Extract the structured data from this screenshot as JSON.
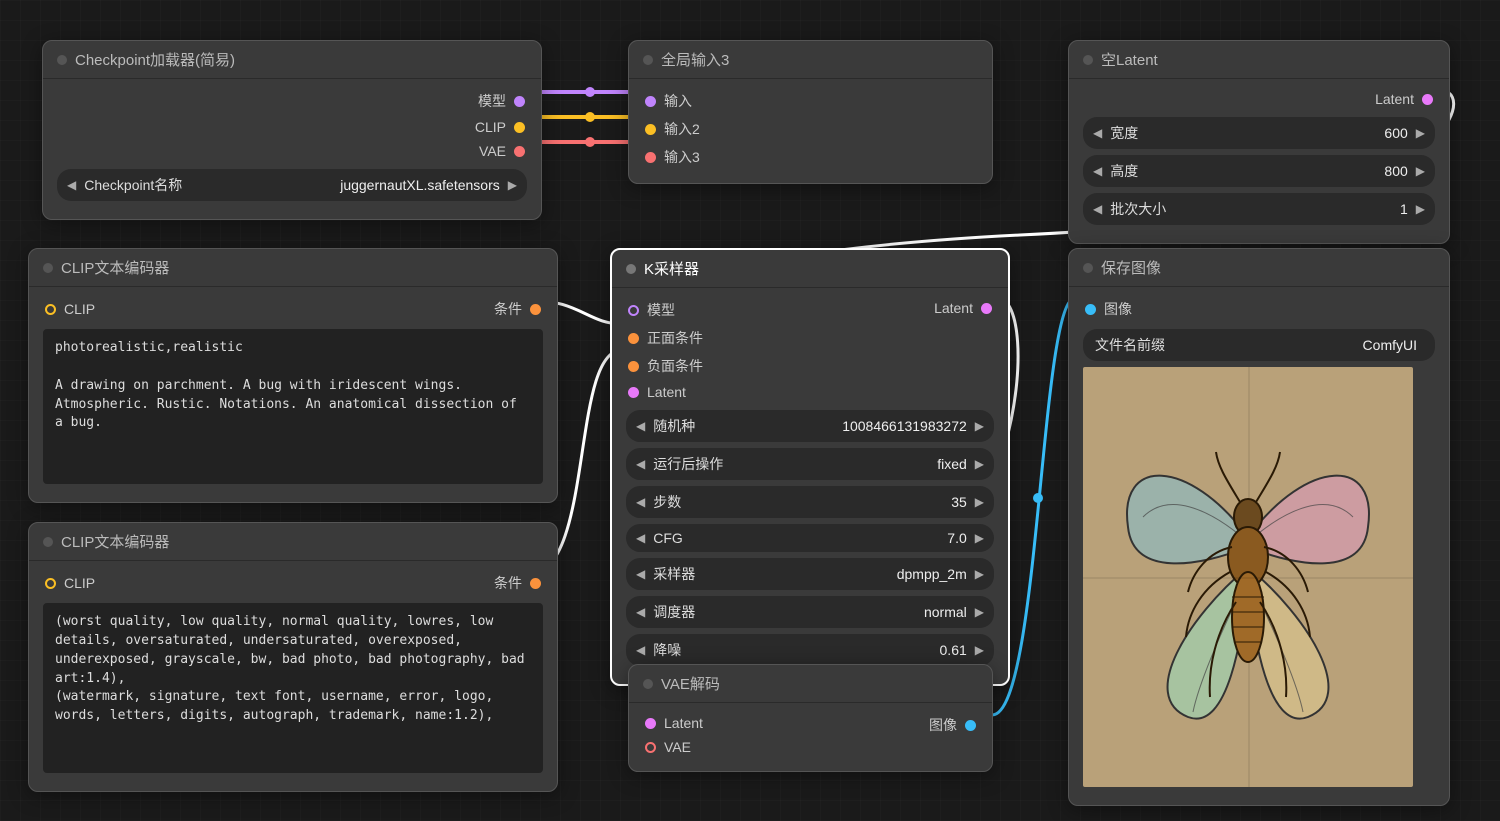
{
  "nodes": {
    "checkpoint_loader": {
      "title": "Checkpoint加载器(简易)",
      "outputs": {
        "model": "模型",
        "clip": "CLIP",
        "vae": "VAE"
      },
      "widget": {
        "label": "Checkpoint名称",
        "value": "juggernautXL.safetensors"
      }
    },
    "global_input": {
      "title": "全局输入3",
      "inputs": {
        "in1": "输入",
        "in2": "输入2",
        "in3": "输入3"
      }
    },
    "empty_latent": {
      "title": "空Latent",
      "outputs": {
        "latent": "Latent"
      },
      "widgets": {
        "width": {
          "label": "宽度",
          "value": "600"
        },
        "height": {
          "label": "高度",
          "value": "800"
        },
        "batch": {
          "label": "批次大小",
          "value": "1"
        }
      }
    },
    "clip_pos": {
      "title": "CLIP文本编码器",
      "inputs": {
        "clip": "CLIP"
      },
      "outputs": {
        "cond": "条件"
      },
      "text": "photorealistic,realistic\n\nA drawing on parchment. A bug with iridescent wings. Atmospheric. Rustic. Notations. An anatomical dissection of a bug."
    },
    "clip_neg": {
      "title": "CLIP文本编码器",
      "inputs": {
        "clip": "CLIP"
      },
      "outputs": {
        "cond": "条件"
      },
      "text": "(worst quality, low quality, normal quality, lowres, low details, oversaturated, undersaturated, overexposed, underexposed, grayscale, bw, bad photo, bad photography, bad art:1.4),\n(watermark, signature, text font, username, error, logo, words, letters, digits, autograph, trademark, name:1.2),"
    },
    "ksampler": {
      "title": "K采样器",
      "inputs": {
        "model": "模型",
        "pos": "正面条件",
        "neg": "负面条件",
        "latent": "Latent"
      },
      "outputs": {
        "latent": "Latent"
      },
      "widgets": {
        "seed": {
          "label": "随机种",
          "value": "1008466131983272"
        },
        "after": {
          "label": "运行后操作",
          "value": "fixed"
        },
        "steps": {
          "label": "步数",
          "value": "35"
        },
        "cfg": {
          "label": "CFG",
          "value": "7.0"
        },
        "sampler": {
          "label": "采样器",
          "value": "dpmpp_2m"
        },
        "scheduler": {
          "label": "调度器",
          "value": "normal"
        },
        "denoise": {
          "label": "降噪",
          "value": "0.61"
        }
      }
    },
    "vae_decode": {
      "title": "VAE解码",
      "inputs": {
        "latent": "Latent",
        "vae": "VAE"
      },
      "outputs": {
        "image": "图像"
      }
    },
    "save_image": {
      "title": "保存图像",
      "inputs": {
        "image": "图像"
      },
      "widget": {
        "label": "文件名前缀",
        "value": "ComfyUI"
      }
    }
  },
  "colors": {
    "model": "#c084fc",
    "clip": "#fbbf24",
    "vae": "#f87171",
    "cond": "#fb923c",
    "latent": "#e879f9",
    "image": "#38bdf8",
    "white": "#ffffff"
  }
}
